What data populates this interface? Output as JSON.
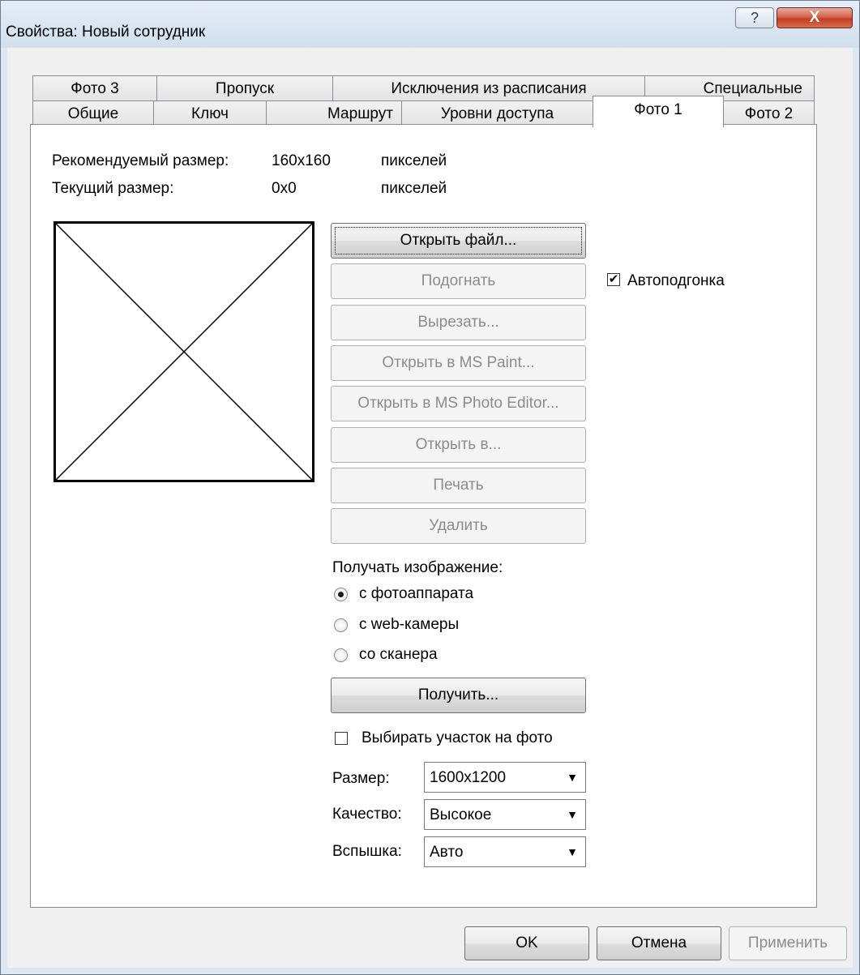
{
  "window": {
    "title": "Свойства: Новый сотрудник",
    "help_glyph": "?",
    "close_glyph": "X"
  },
  "tabs": {
    "row1": [
      "Фото 3",
      "Пропуск",
      "Исключения из расписания",
      "Специальные"
    ],
    "row2": [
      "Общие",
      "Ключ",
      "Маршрут",
      "Уровни доступа",
      "Фото 1",
      "Фото 2"
    ],
    "active": "Фото 1"
  },
  "info": {
    "recommended_label": "Рекомендуемый размер:",
    "recommended_value": "160x160",
    "recommended_unit": "пикселей",
    "current_label": "Текущий размер:",
    "current_value": "0x0",
    "current_unit": "пикселей"
  },
  "buttons": {
    "open_file": "Открыть файл...",
    "fit": "Подогнать",
    "cut": "Вырезать...",
    "open_paint": "Открыть в MS Paint...",
    "open_photo_editor": "Открыть в MS Photo Editor...",
    "open_in": "Открыть в...",
    "print": "Печать",
    "delete": "Удалить",
    "get": "Получить..."
  },
  "autofit": {
    "label": "Автоподгонка",
    "checked": true,
    "check_glyph": "✔"
  },
  "acquire": {
    "title": "Получать изображение:",
    "options": [
      "с фотоаппарата",
      "с web-камеры",
      "со сканера"
    ],
    "selected_index": 0
  },
  "select_region": {
    "label": "Выбирать участок на фото",
    "checked": false
  },
  "settings": {
    "size_label": "Размер:",
    "size_value": "1600x1200",
    "quality_label": "Качество:",
    "quality_value": "Высокое",
    "flash_label": "Вспышка:",
    "flash_value": "Авто",
    "dropdown_glyph": "▼"
  },
  "footer": {
    "ok": "OK",
    "cancel": "Отмена",
    "apply": "Применить"
  }
}
